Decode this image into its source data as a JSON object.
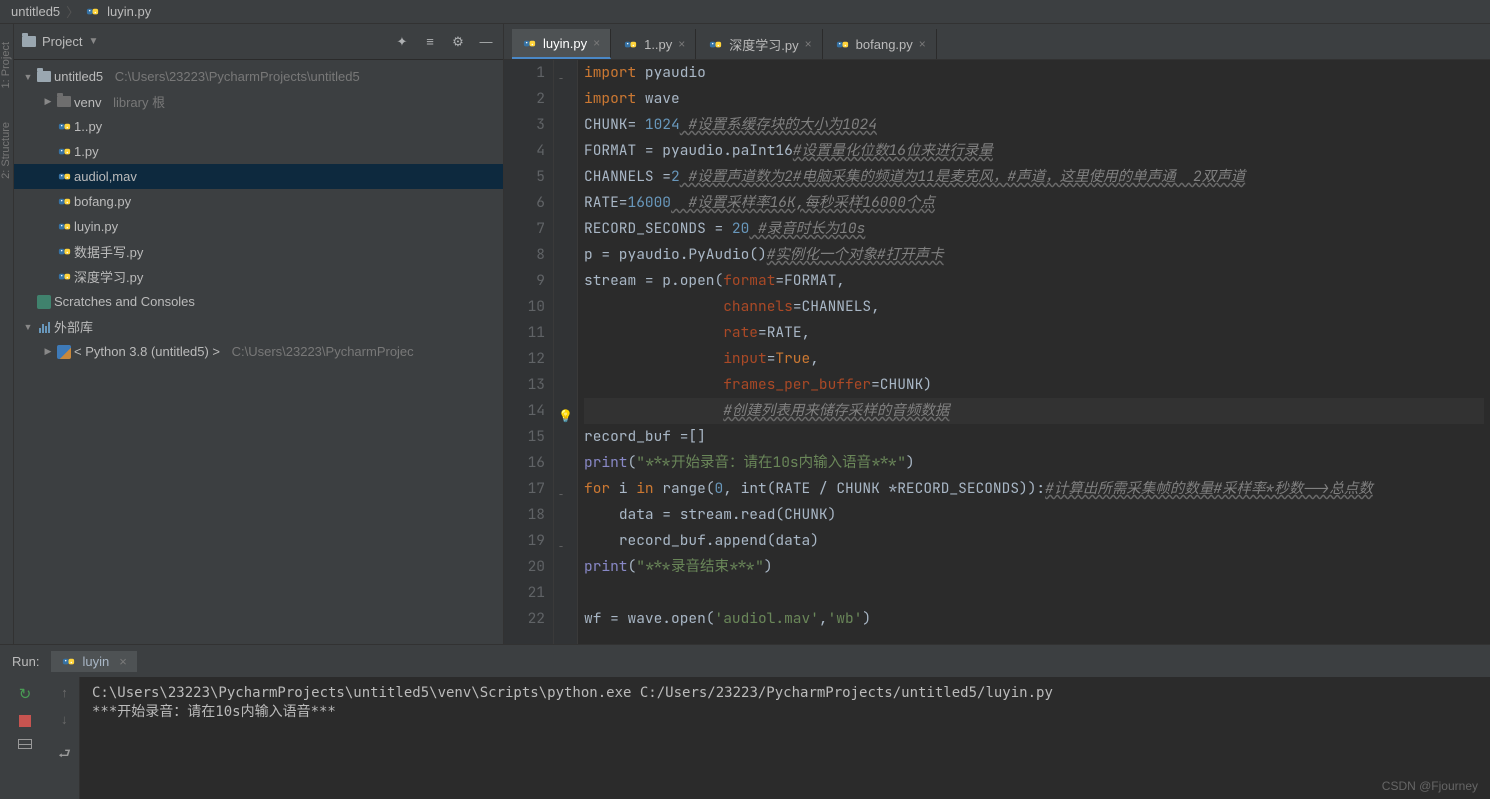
{
  "breadcrumb": {
    "root": "untitled5",
    "file": "luyin.py"
  },
  "project": {
    "header": "Project",
    "items": [
      {
        "label": "untitled5",
        "path": "C:\\Users\\23223\\PycharmProjects\\untitled5",
        "indent": 0,
        "icon": "folder-root",
        "chevron": "down"
      },
      {
        "label": "venv",
        "path": "library 根",
        "indent": 1,
        "icon": "folder-venv",
        "chevron": "right"
      },
      {
        "label": "1..py",
        "indent": 1,
        "icon": "python"
      },
      {
        "label": "1.py",
        "indent": 1,
        "icon": "python"
      },
      {
        "label": "audiol,mav",
        "indent": 1,
        "icon": "python",
        "selected": true
      },
      {
        "label": "bofang.py",
        "indent": 1,
        "icon": "python"
      },
      {
        "label": "luyin.py",
        "indent": 1,
        "icon": "python"
      },
      {
        "label": "数据手写.py",
        "indent": 1,
        "icon": "python"
      },
      {
        "label": "深度学习.py",
        "indent": 1,
        "icon": "python"
      },
      {
        "label": "Scratches and Consoles",
        "indent": 0,
        "icon": "scratch"
      },
      {
        "label": "外部库",
        "indent": 0,
        "icon": "bars",
        "chevron": "down"
      },
      {
        "label": "< Python 3.8 (untitled5) >",
        "path": "C:\\Users\\23223\\PycharmProjec",
        "indent": 1,
        "icon": "pylogo",
        "chevron": "right"
      }
    ]
  },
  "tabs": [
    {
      "label": "luyin.py",
      "active": true
    },
    {
      "label": "1..py"
    },
    {
      "label": "深度学习.py"
    },
    {
      "label": "bofang.py"
    }
  ],
  "lines": [
    "1",
    "2",
    "3",
    "4",
    "5",
    "6",
    "7",
    "8",
    "9",
    "10",
    "11",
    "12",
    "13",
    "14",
    "15",
    "16",
    "17",
    "18",
    "19",
    "20",
    "21",
    "22"
  ],
  "code": {
    "l1": {
      "a": "import",
      "b": " pyaudio"
    },
    "l2": {
      "a": "import",
      "b": " wave"
    },
    "l3": {
      "a": "CHUNK= ",
      "b": "1024",
      "c": " #设置系缓存块的大小为1024"
    },
    "l4": {
      "a": "FORMAT = pyaudio.paInt16",
      "b": "#设置量化位数16位来进行录量"
    },
    "l5": {
      "a": "CHANNELS =",
      "b": "2",
      "c": " #设置声道数为2#电脑采集的频道为11是麦克风，#声道，这里使用的单声通  2双声道"
    },
    "l6": {
      "a": "RATE=",
      "b": "16000",
      "c": "  #设置采样率16K,每秒采样16000个点"
    },
    "l7": {
      "a": "RECORD_SECONDS = ",
      "b": "20",
      "c": " #录音时长为10s"
    },
    "l8": {
      "a": "p = pyaudio.PyAudio()",
      "b": "#实例化一个对象#打开声卡"
    },
    "l9": {
      "a": "stream = p.open(",
      "p1": "format",
      "b": "=FORMAT,"
    },
    "l10": {
      "sp": "                ",
      "p1": "channels",
      "b": "=CHANNELS,"
    },
    "l11": {
      "sp": "                ",
      "p1": "rate",
      "b": "=RATE,"
    },
    "l12": {
      "sp": "                ",
      "p1": "input",
      "b": "=",
      "t": "True",
      "c": ","
    },
    "l13": {
      "sp": "                ",
      "p1": "frames_per_buffer",
      "b": "=CHUNK)"
    },
    "l14": {
      "sp": "                ",
      "b": "#创建列表用来储存采样的音频数据"
    },
    "l15": {
      "a": "record_buf =[]"
    },
    "l16": {
      "a": "print(",
      "s": "\"***开始录音：请在10s内输入语音***\"",
      "b": ")"
    },
    "l17": {
      "a": "for",
      "b": " i ",
      "c": "in",
      "d": " range(",
      "n": "0",
      "e": ", int(RATE / CHUNK *RECORD_SECONDS)):",
      "cm": "#计算出所需采集帧的数量#采样率*秒数-->总点数"
    },
    "l18": {
      "sp": "    ",
      "a": "data = stream.read(CHUNK)"
    },
    "l19": {
      "sp": "    ",
      "a": "record_buf.append(data)"
    },
    "l20": {
      "a": "print(",
      "s": "\"***录音结束***\"",
      "b": ")"
    },
    "l21": {
      "a": ""
    },
    "l22": {
      "a": "wf = wave.open(",
      "s1": "'audiol.mav'",
      "b": ",",
      "s2": "'wb'",
      "c": ")"
    }
  },
  "run": {
    "label": "Run:",
    "tab": "luyin",
    "out1": "C:\\Users\\23223\\PycharmProjects\\untitled5\\venv\\Scripts\\python.exe C:/Users/23223/PycharmProjects/untitled5/luyin.py",
    "out2": "***开始录音：请在10s内输入语音***"
  },
  "watermark": "CSDN @Fjourney",
  "sidebar_left": {
    "t1": "1: Project",
    "t2": "2: Structure"
  }
}
